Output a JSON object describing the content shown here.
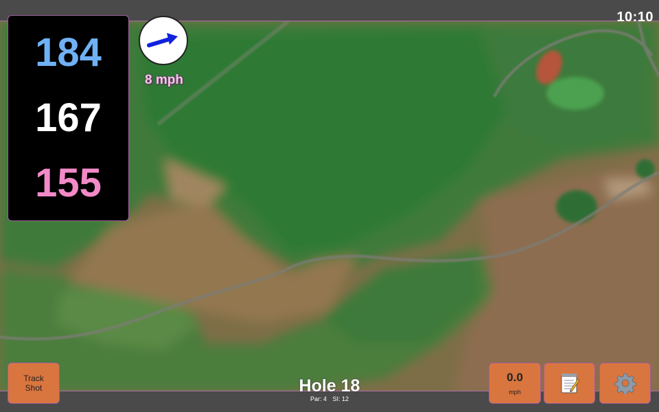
{
  "status": {
    "time": "10:10"
  },
  "distances": {
    "back": "184",
    "middle": "167",
    "front": "155"
  },
  "wind": {
    "speed": "8 mph",
    "arrow_color": "#1122dd",
    "dial_icon": "wind-direction-arrow"
  },
  "buttons": {
    "track_shot_line1": "Track",
    "track_shot_line2": "Shot",
    "speed_value": "0.0",
    "speed_unit": "mph",
    "notes_icon": "notepad-icon",
    "settings_icon": "gear-icon"
  },
  "hole": {
    "title": "Hole 18",
    "par": "Par: 4",
    "si": "SI: 12"
  },
  "colors": {
    "accent_button": "#d9753f",
    "back_distance": "#6fb1f4",
    "front_distance": "#f28ac8",
    "border": "#a05d9c"
  }
}
